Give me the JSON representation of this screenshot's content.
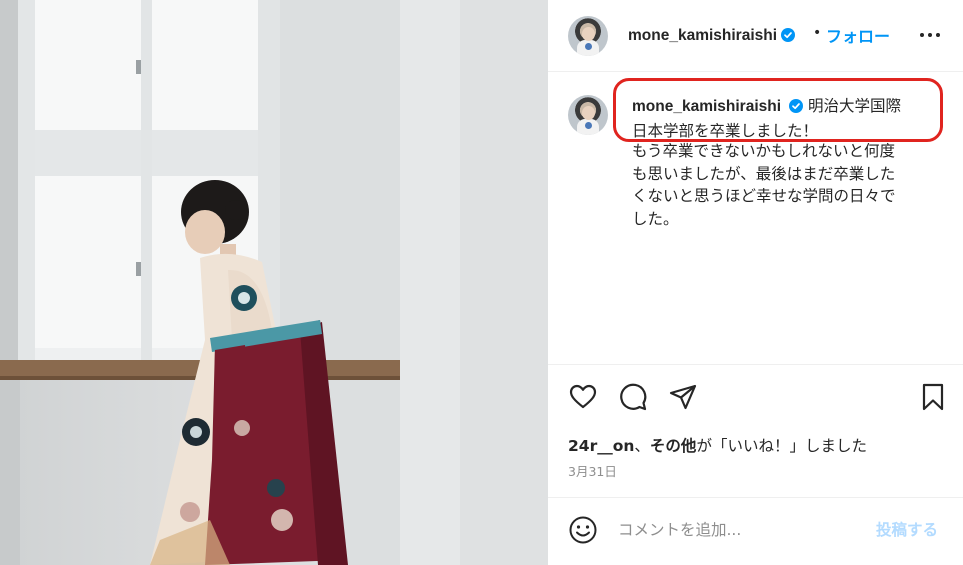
{
  "post": {
    "username": "mone_kamishiraishi",
    "separator": "•",
    "follow_label": "フォロー",
    "caption_lines": [
      "明治大学国際",
      "日本学部を卒業しました！",
      "もう卒業できないかもしれないと何度",
      "も思いましたが、最後はまだ卒業した",
      "くないと思うほど幸せな学問の日々で",
      "した。"
    ],
    "likes_user": "24r__on",
    "likes_sep": "、",
    "likes_others": "その他",
    "likes_suffix": "が「いいね！」しました",
    "date": "3月31日",
    "comment_placeholder": "コメントを追加...",
    "post_label": "投稿する"
  },
  "colors": {
    "accent_blue": "#0095f6",
    "highlight_red": "#e0241f",
    "kimono_cream": "#efe3d6",
    "hakama_maroon": "#7a1c2e"
  },
  "icons": {
    "verified": "verified-badge-icon",
    "more": "more-options-icon",
    "like": "heart-icon",
    "comment": "comment-icon",
    "share": "paper-plane-icon",
    "save": "bookmark-icon",
    "emoji": "emoji-icon"
  }
}
